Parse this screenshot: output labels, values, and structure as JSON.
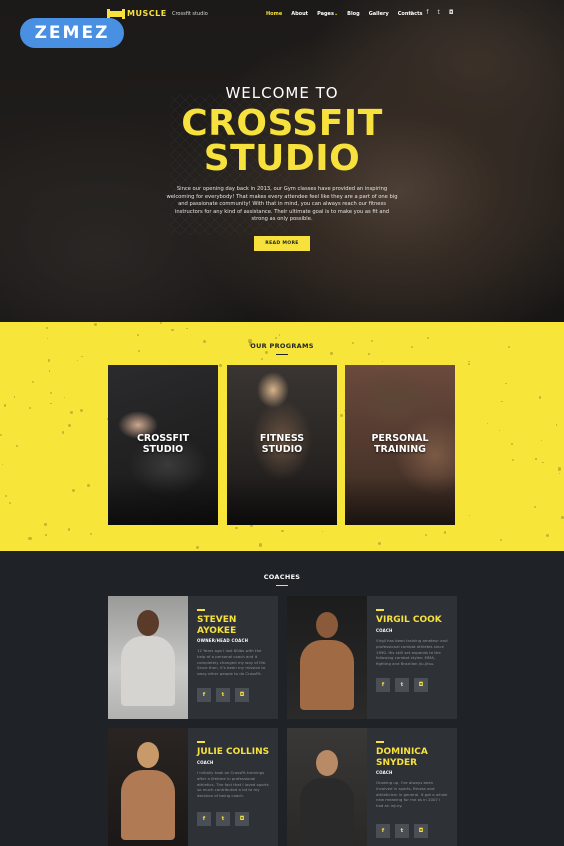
{
  "badge": {
    "brand": "ZEMEZ"
  },
  "nav": {
    "logo": "MUSCLE",
    "tagline": "Crossfit studio",
    "items": [
      "Home",
      "About",
      "Pages",
      "Blog",
      "Gallery",
      "Contacts"
    ],
    "pages_caret": "⌄",
    "search_icon": "⌕",
    "social": [
      "f",
      "t",
      "◘"
    ]
  },
  "hero": {
    "welcome": "WELCOME TO",
    "title_line1": "CROSSFIT",
    "title_line2": "STUDIO",
    "text": "Since our opening day back in 2013, our Gym classes have provided an inspiring welcoming for everybody! That makes every attendee feel like they are a part of one big and passionate community! With that in mind, you can always reach our fitness instructors for any kind of assistance. Their ultimate goal is to make you as fit and strong as only possible.",
    "button": "READ MORE"
  },
  "programs": {
    "title": "OUR PROGRAMS",
    "cards": [
      {
        "line1": "CROSSFIT",
        "line2": "STUDIO"
      },
      {
        "line1": "FITNESS",
        "line2": "STUDIO"
      },
      {
        "line1": "PERSONAL",
        "line2": "TRAINING"
      }
    ]
  },
  "coaches": {
    "title": "COACHES",
    "list": [
      {
        "name1": "STEVEN",
        "name2": "AYOKEE",
        "role": "OWNER/HEAD COACH",
        "bio": "12 Years ago I lost 80lbs with the help of a personal coach and it completely changed my way of life. Since then, it's been my mission to sway other people to do CrossFit."
      },
      {
        "name1": "VIRGIL COOK",
        "name2": "",
        "role": "COACH",
        "bio": "Virgil has been training amateur and professional combat athletes since 1990. His skill set expands to the following combat styles: MMA, fighting and Brazilian Jiu-Jitsu."
      },
      {
        "name1": "JULIE COLLINS",
        "name2": "",
        "role": "COACH",
        "bio": "I initially took on CrossFit trainings after a lifetime in professional athletics. The fact that I loved sports so much contributed a lot to my decision of being coach."
      },
      {
        "name1": "DOMINICA",
        "name2": "SNYDER",
        "role": "COACH",
        "bio": "Growing up, I've always been involved in sports, fitness and athleticism in general. It got a whole new meaning for me as in 2007 I had an injury."
      }
    ],
    "social": [
      "f",
      "t",
      "◘"
    ]
  },
  "colors": {
    "accent": "#f7e13c",
    "dark": "#1f2226",
    "card": "#2e3136",
    "badge": "#4a90e2"
  }
}
